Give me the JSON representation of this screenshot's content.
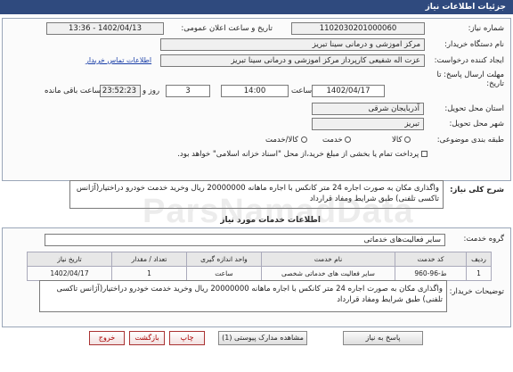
{
  "header": {
    "title": "جزئیات اطلاعات نیاز"
  },
  "form": {
    "need_number_label": "شماره نیاز:",
    "need_number": "1102030201000060",
    "announce_label": "تاریخ و ساعت اعلان عمومی:",
    "announce_value": "1402/04/13 - 13:36",
    "buyer_org_label": "نام دستگاه خریدار:",
    "buyer_org": "مرکز اموزشی و درمانی سینا تبریز",
    "creator_label": "ایجاد کننده درخواست:",
    "creator": "عزت اله شفیعی  کارپرداز مرکز اموزشی و درمانی سینا تبریز",
    "buyer_contact_link": "اطلاعات تماس خریدار",
    "deadline_label_1": "مهلت ارسال پاسخ: تا",
    "deadline_label_2": "تاریخ:",
    "deadline_date": "1402/04/17",
    "hour_label": "ساعت",
    "deadline_time": "14:00",
    "days_value": "3",
    "days_label": "روز و",
    "remaining_time": "23:52:23",
    "remaining_label": "ساعت باقی مانده",
    "province_label": "استان محل تحویل:",
    "province": "آذربایجان شرقی",
    "city_label": "شهر محل تحویل:",
    "city": "تبریز",
    "category_label": "طبقه بندی موضوعی:",
    "category_options": [
      "کالا",
      "خدمت",
      "کالا/خدمت"
    ],
    "payment_note": "پرداخت تمام یا بخشی از مبلغ خرید،از محل \"اسناد خزانه اسلامی\" خواهد بود.",
    "summary_label": "شرح کلی نیاز:",
    "summary": "واگذاری مکان به صورت اجاره 24 متر کانکس با اجاره ماهانه 20000000 ریال وخرید خدمت خودرو دراختیار(آژانس تاکسی تلفنی) طبق شرایط ومفاد قرارداد"
  },
  "services": {
    "section_title": "اطلاعات خدمات مورد نیاز",
    "group_label": "گروه خدمت:",
    "group_value": "سایر فعالیت‌های خدماتی",
    "columns": [
      "ردیف",
      "کد خدمت",
      "نام خدمت",
      "واحد اندازه گیری",
      "تعداد / مقدار",
      "تاریخ نیاز"
    ],
    "rows": [
      {
        "index": "1",
        "code": "ط-96-960",
        "name": "سایر فعالیت های خدماتی شخصی",
        "unit": "ساعت",
        "qty": "1",
        "date": "1402/04/17"
      }
    ],
    "buyer_notes_label": "توضیحات خریدار:",
    "buyer_notes": "واگذاری مکان به صورت اجاره 24 متر کانکس با اجاره ماهانه 20000000 ریال وخرید خدمت خودرو دراختیار(آژانس تاکسی تلفنی) طبق شرایط ومفاد قرارداد"
  },
  "buttons": {
    "reply": "پاسخ به نیاز",
    "view_docs": "مشاهده مدارک پیوستی (1)",
    "print": "چاپ",
    "back": "بازگشت",
    "exit": "خروج"
  },
  "watermark": "ParsNamadData"
}
